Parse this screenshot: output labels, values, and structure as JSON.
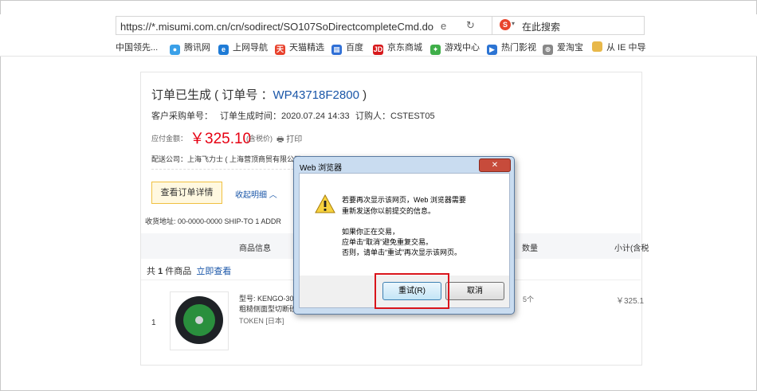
{
  "browser": {
    "url": "https://*.misumi.com.cn/cn/sodirect/SO107SoDirectcompleteCmd.do",
    "search_placeholder": "在此搜索",
    "search_logo": "S",
    "favorites": [
      {
        "label": "中国领先...",
        "icon": "",
        "color": ""
      },
      {
        "label": "腾讯网",
        "icon": "●",
        "color": "#3aa0e8"
      },
      {
        "label": "上网导航",
        "icon": "e",
        "color": "#1e7bd6"
      },
      {
        "label": "天猫精选",
        "icon": "天",
        "color": "#e8412c"
      },
      {
        "label": "百度",
        "icon": "▦",
        "color": "#2f6fd6"
      },
      {
        "label": "京东商城",
        "icon": "JD",
        "color": "#d7191c"
      },
      {
        "label": "游戏中心",
        "icon": "✦",
        "color": "#3fae49"
      },
      {
        "label": "热门影视",
        "icon": "▶",
        "color": "#2c74d3"
      },
      {
        "label": "爱淘宝",
        "icon": "⊕",
        "color": "#888888"
      },
      {
        "label": "从 IE 中导",
        "icon": "",
        "color": "#e8b84a"
      }
    ]
  },
  "order": {
    "title_prefix": "订单已生成 ( 订单号 ：",
    "order_number": "WP43718F2800",
    "title_suffix": ")",
    "customer_po_label": "客户采购单号：",
    "created_time": "订单生成时间：2020.07.24 14:33",
    "orderer": "订购人：CSTEST05",
    "amount_label": "应付金额：",
    "amount": "￥325.10",
    "tax_note": "(含税价)",
    "print_label": "打印",
    "company": "配送公司：上海飞力士 ( 上海营顶商贸有限公司 )",
    "detail_button": "查看订单详情",
    "collapse_label": "收起明细",
    "shipping_address": "收货地址:  00-0000-0000   SHIP-TO 1 ADDR",
    "table_headers": {
      "product": "商品信息",
      "quantity": "数量",
      "subtotal": "小计(含税"
    },
    "summary": {
      "prefix": "共",
      "count": "1",
      "suffix": "件商品",
      "link": "立即查看"
    },
    "item": {
      "index": "1",
      "model": "型号: KENGO-30",
      "desc": "粗糙侧面型切断砂",
      "brand": "TOKEN [日本]",
      "qty": "5个",
      "price": "￥325.1"
    }
  },
  "dialog": {
    "title": "Web 浏览器",
    "close": "✕",
    "message_lines": [
      "若要再次显示该网页，Web 浏览器需要",
      "重新发送你以前提交的信息。",
      "",
      "如果你正在交易，",
      "应单击“取消”避免重复交易。",
      "否则，请单击“重试”再次显示该网页。"
    ],
    "retry_button": "重试(R)",
    "cancel_button": "取消"
  },
  "colors": {
    "accent_link": "#1a56a8",
    "price_red": "#e60012",
    "highlight_red": "#d9141b"
  }
}
